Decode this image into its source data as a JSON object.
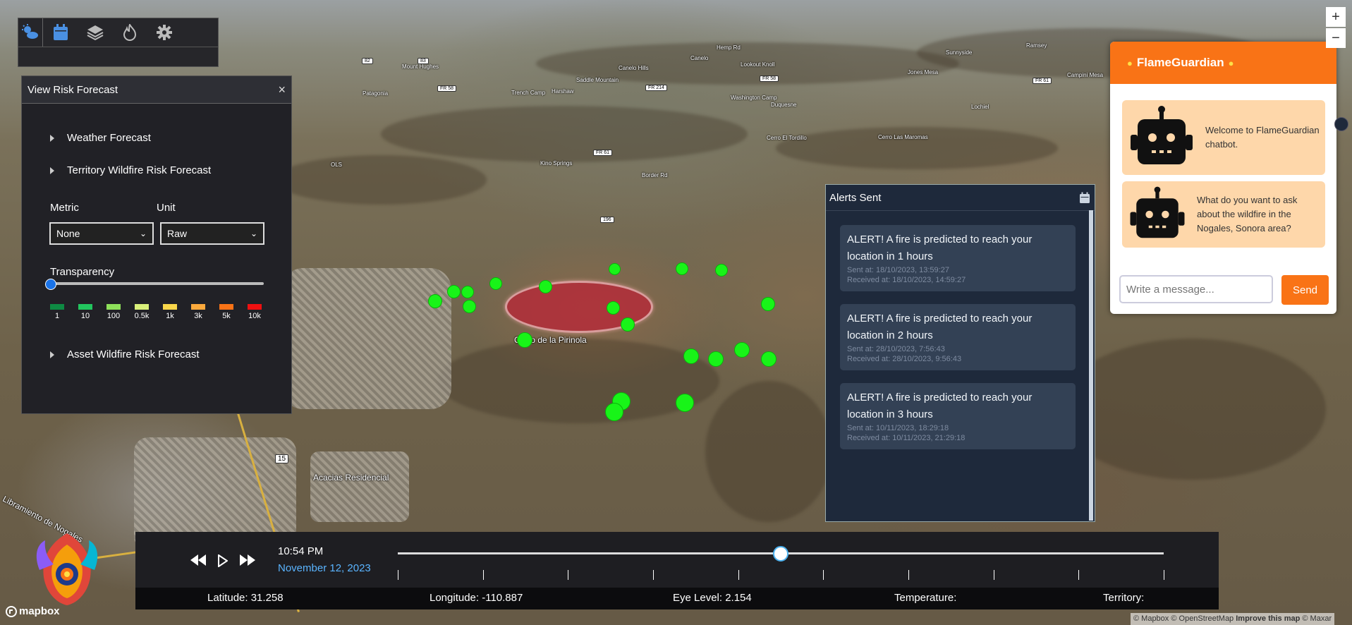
{
  "map": {
    "place_labels": [
      {
        "text": "Hemp Rd"
      },
      {
        "text": "Canelo"
      },
      {
        "text": "Sunnyside"
      },
      {
        "text": "Ramsey"
      },
      {
        "text": "Mount Hughes"
      },
      {
        "text": "Saddle Mountain"
      },
      {
        "text": "Canelo Hills"
      },
      {
        "text": "Lookout Knoll"
      },
      {
        "text": "Jones Mesa"
      },
      {
        "text": "Campini Mesa"
      },
      {
        "text": "Patagonia"
      },
      {
        "text": "Trench Camp"
      },
      {
        "text": "Harshaw"
      },
      {
        "text": "Washington Camp"
      },
      {
        "text": "Duquesne"
      },
      {
        "text": "Lochiel"
      },
      {
        "text": "Cerro El Tordillo"
      },
      {
        "text": "Cerro Las Maromas"
      },
      {
        "text": "Kino Springs"
      },
      {
        "text": "Border Rd"
      },
      {
        "text": "OLS"
      },
      {
        "text": "Cerro de la Pirinola"
      },
      {
        "text": "Acacias Residencial"
      },
      {
        "text": "Libramiento de Nogales"
      }
    ],
    "route_shields": [
      "82",
      "83",
      "FR 58",
      "FR 214",
      "FR 58",
      "FR 61",
      "FR 61",
      "196",
      "15"
    ]
  },
  "toolbar": {
    "icons": [
      "weather-icon",
      "calendar-icon",
      "layers-icon",
      "fire-icon",
      "gear-icon"
    ]
  },
  "risk_panel": {
    "title": "View Risk Forecast",
    "close_label": "×",
    "sections": {
      "weather": "Weather Forecast",
      "territory": "Territory Wildfire Risk Forecast",
      "asset": "Asset Wildfire Risk Forecast"
    },
    "metric_label": "Metric",
    "metric_value": "None",
    "unit_label": "Unit",
    "unit_value": "Raw",
    "transparency_label": "Transparency",
    "transparency_value": 0,
    "legend": [
      {
        "label": "1",
        "color": "#0e8a43"
      },
      {
        "label": "10",
        "color": "#22c55e"
      },
      {
        "label": "100",
        "color": "#8ee05a"
      },
      {
        "label": "0.5k",
        "color": "#d9f07a"
      },
      {
        "label": "1k",
        "color": "#f9d64a"
      },
      {
        "label": "3k",
        "color": "#fba93c"
      },
      {
        "label": "5k",
        "color": "#f97316"
      },
      {
        "label": "10k",
        "color": "#ef1010"
      }
    ]
  },
  "alerts": {
    "title": "Alerts Sent",
    "items": [
      {
        "message": "ALERT! A fire is predicted to reach your location in 1 hours",
        "sent": "Sent at: 18/10/2023, 13:59:27",
        "received": "Received at: 18/10/2023, 14:59:27"
      },
      {
        "message": "ALERT! A fire is predicted to reach your location in 2 hours",
        "sent": "Sent at: 28/10/2023, 7:56:43",
        "received": "Received at: 28/10/2023, 9:56:43"
      },
      {
        "message": "ALERT! A fire is predicted to reach your location in 3 hours",
        "sent": "Sent at: 10/11/2023, 18:29:18",
        "received": "Received at: 10/11/2023, 21:29:18"
      }
    ]
  },
  "chat": {
    "title": "FlameGuardian",
    "messages": [
      "Welcome to FlameGuardian chatbot.",
      "What do you want to ask about the wildfire in the Nogales, Sonora area?"
    ],
    "input_placeholder": "Write a message...",
    "send_label": "Send",
    "accent_color": "#f97316"
  },
  "timeline": {
    "time": "10:54 PM",
    "date": "November 12, 2023",
    "position_fraction": 0.5,
    "tick_count": 10
  },
  "status": {
    "latitude": "Latitude: 31.258",
    "longitude": "Longitude: -110.887",
    "eye_level": "Eye Level: 2.154",
    "temperature": "Temperature:",
    "territory": "Territory:"
  },
  "zoom": {
    "in": "+",
    "out": "−"
  },
  "attribution": {
    "mapbox": "© Mapbox",
    "osm": "© OpenStreetMap",
    "improve": "Improve this map",
    "maxar": "© Maxar"
  },
  "mapbox_logo_text": "mapbox"
}
